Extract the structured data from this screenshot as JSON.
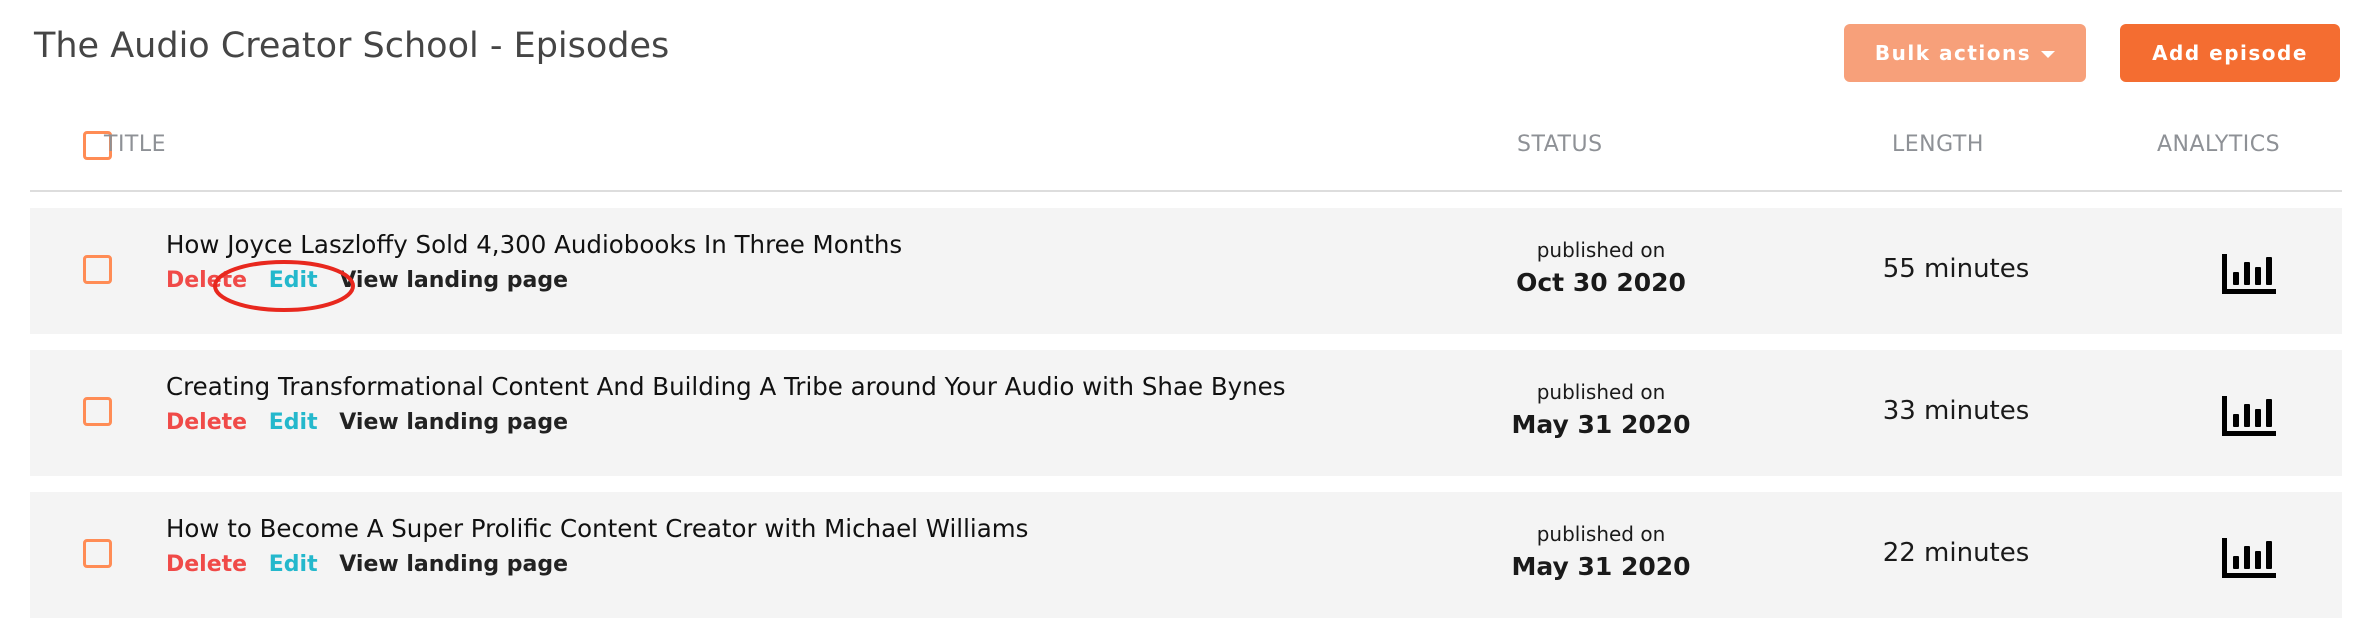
{
  "page": {
    "title": "The Audio Creator School - Episodes"
  },
  "toolbar": {
    "bulk_actions_label": "Bulk actions",
    "add_episode_label": "Add episode"
  },
  "colors": {
    "accent": "#F46D31",
    "accent_light": "#F7A07A",
    "checkbox": "#FF8C55",
    "delete": "#F04A48",
    "edit": "#24B8CC",
    "annotation": "#E8281E"
  },
  "table": {
    "columns": {
      "title": "TITLE",
      "status": "STATUS",
      "length": "LENGTH",
      "analytics": "ANALYTICS"
    },
    "rows": [
      {
        "title": "How Joyce Laszloffy Sold 4,300 Audiobooks In Three Months",
        "actions": {
          "delete": "Delete",
          "edit": "Edit",
          "view": "View landing page"
        },
        "status_prefix": "published on",
        "status_date": "Oct 30 2020",
        "length": "55 minutes",
        "analytics_icon": "bar-chart-icon"
      },
      {
        "title": "Creating Transformational Content And Building A Tribe around Your Audio with Shae Bynes",
        "actions": {
          "delete": "Delete",
          "edit": "Edit",
          "view": "View landing page"
        },
        "status_prefix": "published on",
        "status_date": "May 31 2020",
        "length": "33 minutes",
        "analytics_icon": "bar-chart-icon"
      },
      {
        "title": "How to Become A Super Prolific Content Creator with Michael Williams",
        "actions": {
          "delete": "Delete",
          "edit": "Edit",
          "view": "View landing page"
        },
        "status_prefix": "published on",
        "status_date": "May 31 2020",
        "length": "22 minutes",
        "analytics_icon": "bar-chart-icon"
      }
    ]
  },
  "annotation": {
    "shape": "ellipse",
    "target": "Edit link, first row"
  }
}
